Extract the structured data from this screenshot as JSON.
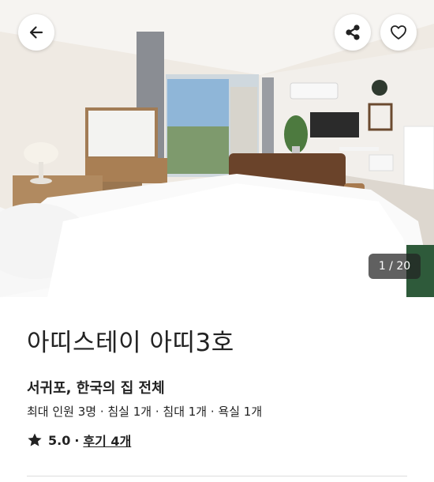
{
  "gallery": {
    "photo_label": "hotel room photo",
    "current_index": 1,
    "total": 20,
    "counter_text": "1 / 20"
  },
  "top_actions": {
    "back_icon": "arrow-left-icon",
    "share_icon": "share-icon",
    "like_icon": "heart-outline-icon"
  },
  "listing": {
    "title": "아띠스테이 아띠3호",
    "subtitle": "서귀포, 한국의 집 전체",
    "details": "최대 인원 3명 · 침실 1개 · 침대 1개 · 욕실 1개",
    "rating": "5.0",
    "separator": "·",
    "reviews_link": "후기 4개",
    "star_icon": "star-icon"
  },
  "colors": {
    "text": "#222222",
    "counter_bg": "#3a3a3a",
    "divider": "#dddddd"
  }
}
